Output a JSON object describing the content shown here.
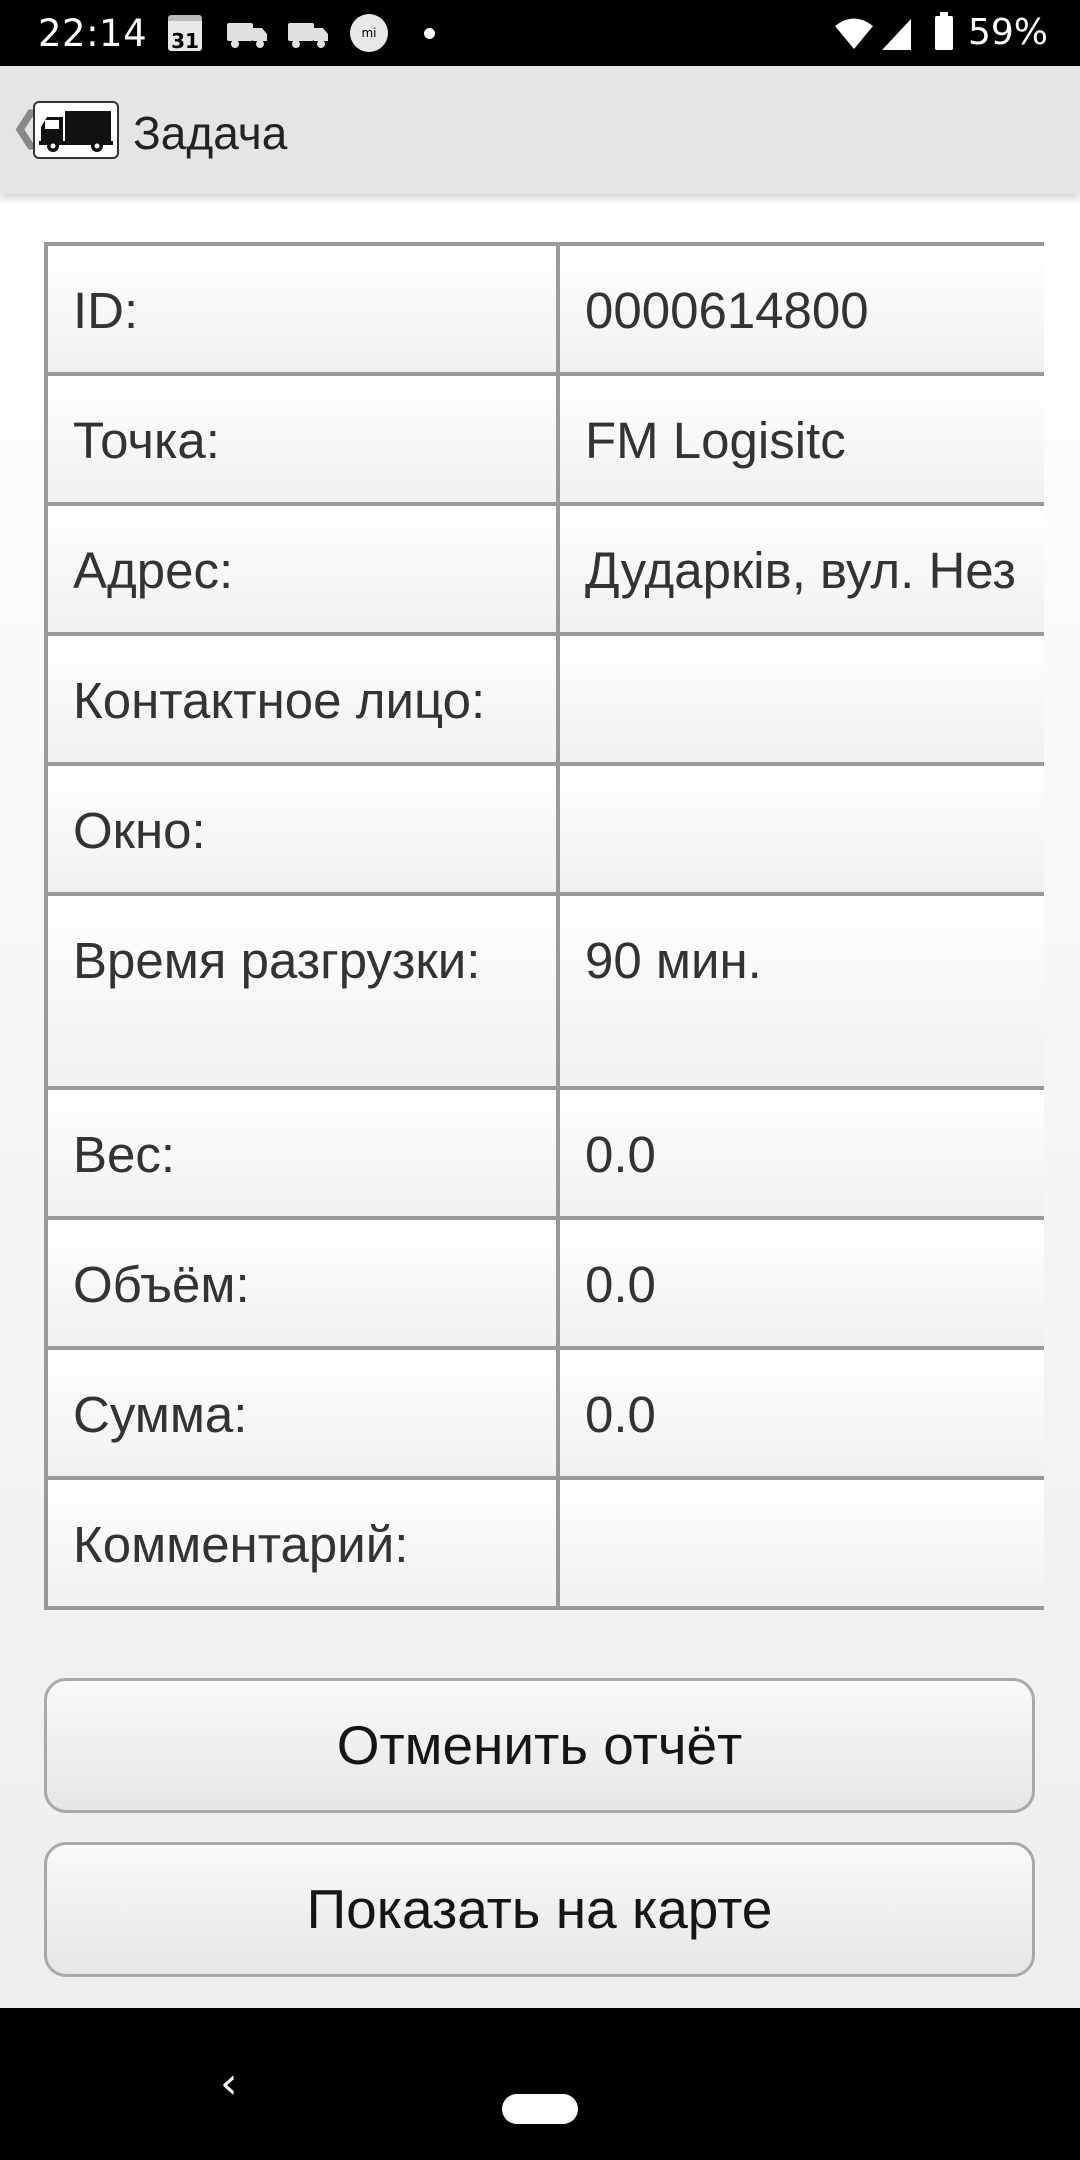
{
  "status_bar": {
    "time": "22:14",
    "calendar_day": "31",
    "mi_label": "mi",
    "battery_percent": "59%"
  },
  "app_bar": {
    "back_glyph": "❮",
    "title": "Задача"
  },
  "details": {
    "rows": [
      {
        "label": "ID:",
        "value": "0000614800"
      },
      {
        "label": "Точка:",
        "value": "FM Logisitc"
      },
      {
        "label": "Адрес:",
        "value": "Дударків, вул. Нез"
      },
      {
        "label": "Контактное лицо:",
        "value": ""
      },
      {
        "label": "Окно:",
        "value": ""
      },
      {
        "label": "Время разгрузки:",
        "value": "90 мин."
      },
      {
        "label": "Вес:",
        "value": "0.0"
      },
      {
        "label": "Объём:",
        "value": "0.0"
      },
      {
        "label": "Сумма:",
        "value": "0.0"
      },
      {
        "label": "Комментарий:",
        "value": ""
      }
    ]
  },
  "buttons": {
    "cancel_report": "Отменить отчёт",
    "show_on_map": "Показать на карте"
  },
  "nav_bar": {
    "back_glyph": "‹"
  }
}
